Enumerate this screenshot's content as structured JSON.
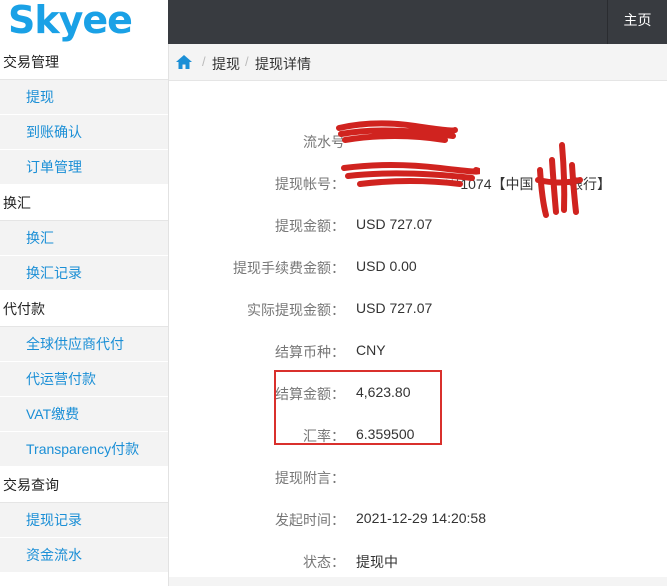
{
  "header": {
    "logo": "Skyee",
    "home_link": "主页"
  },
  "sidebar": {
    "groups": [
      {
        "title": "交易管理",
        "items": [
          "提现",
          "到账确认",
          "订单管理"
        ]
      },
      {
        "title": "换汇",
        "items": [
          "换汇",
          "换汇记录"
        ]
      },
      {
        "title": "代付款",
        "items": [
          "全球供应商代付",
          "代运营付款",
          "VAT缴费",
          "Transparency付款"
        ]
      },
      {
        "title": "交易查询",
        "items": [
          "提现记录",
          "资金流水"
        ]
      }
    ]
  },
  "breadcrumb": {
    "items": [
      "提现",
      "提现详情"
    ]
  },
  "detail": {
    "serial_label": "流水号",
    "account_label": "提现帐号：",
    "account_value": "***1074【中国",
    "account_bank_suffix": "银行】",
    "amount_label": "提现金额：",
    "amount_value": "USD  727.07",
    "fee_label": "提现手续费金额：",
    "fee_value": "USD  0.00",
    "actual_label": "实际提现金额：",
    "actual_value": "USD  727.07",
    "currency_label": "结算币种：",
    "currency_value": "CNY",
    "settle_label": "结算金额：",
    "settle_value": "4,623.80",
    "rate_label": "汇率：",
    "rate_value": "6.359500",
    "note_label": "提现附言：",
    "note_value": "",
    "time_label": "发起时间：",
    "time_value": "2021-12-29 14:20:58",
    "status_label": "状态：",
    "status_value": "提现中"
  },
  "colors": {
    "brand": "#1aa1e6",
    "topbar": "#383b40",
    "link": "#1b8fd6",
    "highlight_border": "#d9302c",
    "redaction": "#d0231f"
  }
}
